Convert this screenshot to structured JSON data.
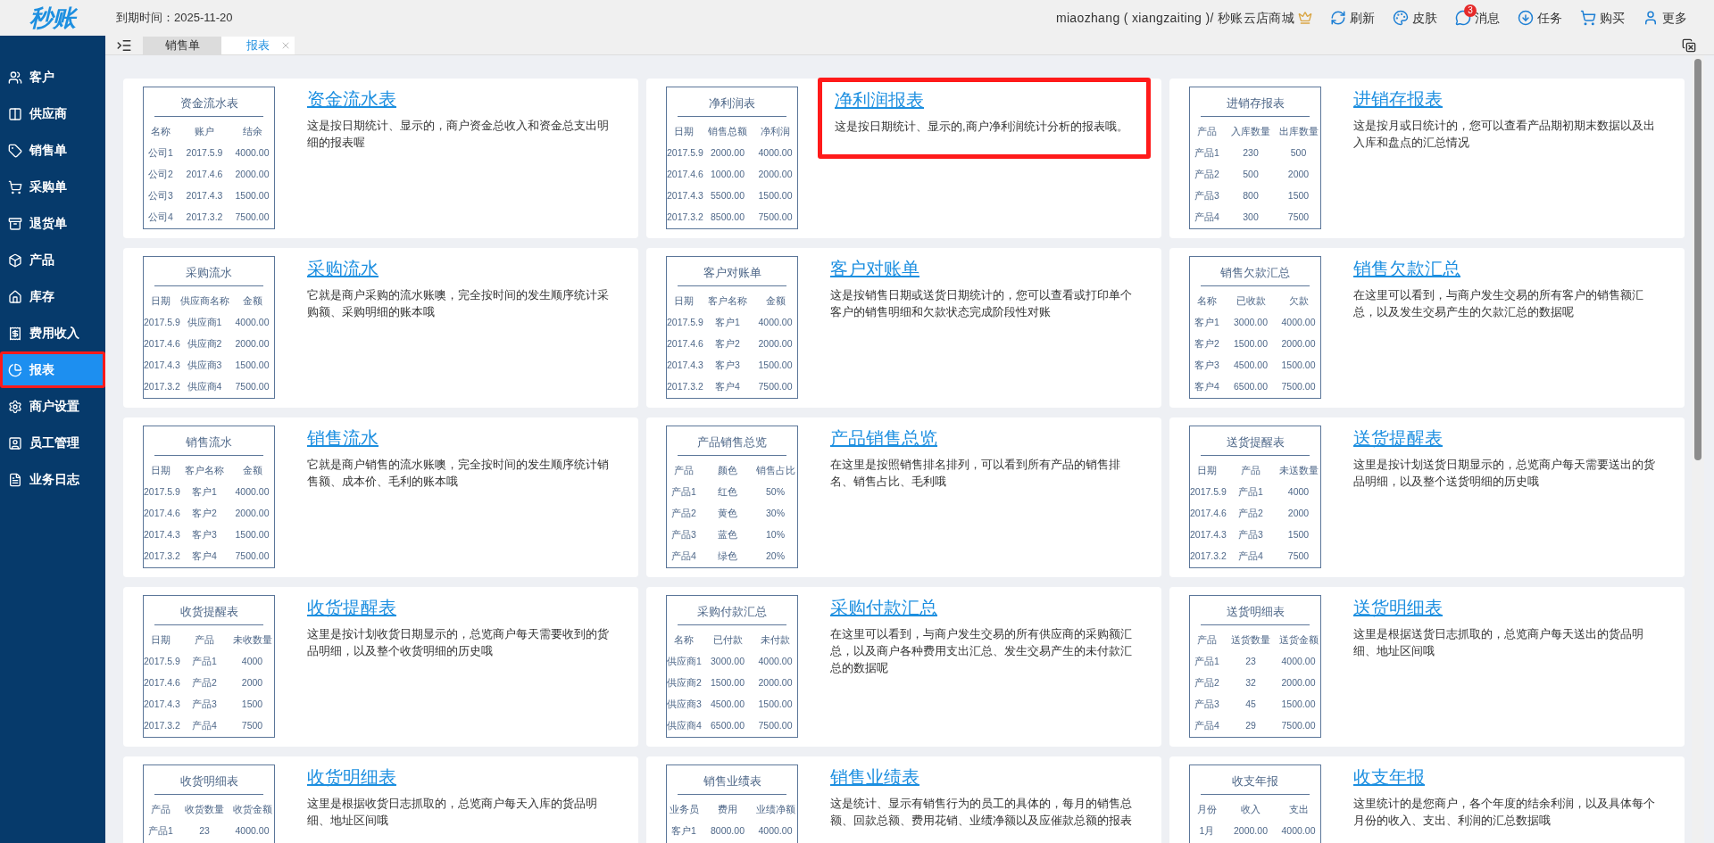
{
  "header": {
    "logo": "秒账",
    "expiry": "到期时间：2025-11-20",
    "account": "miaozhang ( xiangzaiting )/ 秒账云店商城",
    "actions": [
      {
        "kind": "refresh",
        "label": "刷新"
      },
      {
        "kind": "skin",
        "label": "皮肤"
      },
      {
        "kind": "message",
        "label": "消息",
        "badge": "3"
      },
      {
        "kind": "task",
        "label": "任务"
      },
      {
        "kind": "buy",
        "label": "购买"
      },
      {
        "kind": "more",
        "label": "更多"
      }
    ]
  },
  "tabs": [
    {
      "label": "销售单",
      "selected": false
    },
    {
      "label": "报表",
      "selected": true
    }
  ],
  "sidebar": {
    "items": [
      {
        "label": "客户",
        "selected": false,
        "highlighted": false
      },
      {
        "label": "供应商",
        "selected": false,
        "highlighted": false
      },
      {
        "label": "销售单",
        "selected": false,
        "highlighted": false
      },
      {
        "label": "采购单",
        "selected": false,
        "highlighted": false
      },
      {
        "label": "退货单",
        "selected": false,
        "highlighted": false
      },
      {
        "label": "产品",
        "selected": false,
        "highlighted": false
      },
      {
        "label": "库存",
        "selected": false,
        "highlighted": false
      },
      {
        "label": "费用收入",
        "selected": false,
        "highlighted": false
      },
      {
        "label": "报表",
        "selected": true,
        "highlighted": true
      },
      {
        "label": "商户设置",
        "selected": false,
        "highlighted": false
      },
      {
        "label": "员工管理",
        "selected": false,
        "highlighted": false
      },
      {
        "label": "业务日志",
        "selected": false,
        "highlighted": false
      }
    ]
  },
  "reports": [
    {
      "title": "资金流水表",
      "description": "这是按日期统计、显示的，商户资金总收入和资金总支出明细的报表喔",
      "highlighted": false,
      "preview": {
        "title": "资金流水表",
        "columns": [
          "名称",
          "账户",
          "结余"
        ],
        "rows": [
          [
            "公司1",
            "2017.5.9",
            "4000.00"
          ],
          [
            "公司2",
            "2017.4.6",
            "2000.00"
          ],
          [
            "公司3",
            "2017.4.3",
            "1500.00"
          ],
          [
            "公司4",
            "2017.3.2",
            "7500.00"
          ]
        ]
      }
    },
    {
      "title": "净利润报表",
      "description": "这是按日期统计、显示的,商户净利润统计分析的报表哦。",
      "highlighted": true,
      "preview": {
        "title": "净利润表",
        "columns": [
          "日期",
          "销售总额",
          "净利润"
        ],
        "rows": [
          [
            "2017.5.9",
            "2000.00",
            "4000.00"
          ],
          [
            "2017.4.6",
            "1000.00",
            "2000.00"
          ],
          [
            "2017.4.3",
            "5500.00",
            "1500.00"
          ],
          [
            "2017.3.2",
            "8500.00",
            "7500.00"
          ]
        ]
      }
    },
    {
      "title": "进销存报表",
      "description": "这是按月或日统计的，您可以查看产品期初期末数据以及出入库和盘点的汇总情况",
      "highlighted": false,
      "preview": {
        "title": "进销存报表",
        "columns": [
          "产品",
          "入库数量",
          "出库数量"
        ],
        "rows": [
          [
            "产品1",
            "230",
            "500"
          ],
          [
            "产品2",
            "500",
            "2000"
          ],
          [
            "产品3",
            "800",
            "1500"
          ],
          [
            "产品4",
            "300",
            "7500"
          ]
        ]
      }
    },
    {
      "title": "采购流水",
      "description": "它就是商户采购的流水账噢，完全按时间的发生顺序统计采购额、采购明细的账本哦",
      "highlighted": false,
      "preview": {
        "title": "采购流水",
        "columns": [
          "日期",
          "供应商名称",
          "金额"
        ],
        "rows": [
          [
            "2017.5.9",
            "供应商1",
            "4000.00"
          ],
          [
            "2017.4.6",
            "供应商2",
            "2000.00"
          ],
          [
            "2017.4.3",
            "供应商3",
            "1500.00"
          ],
          [
            "2017.3.2",
            "供应商4",
            "7500.00"
          ]
        ]
      }
    },
    {
      "title": "客户对账单",
      "description": "这是按销售日期或送货日期统计的，您可以查看或打印单个客户的销售明细和欠款状态完成阶段性对账",
      "highlighted": false,
      "preview": {
        "title": "客户对账单",
        "columns": [
          "日期",
          "客户名称",
          "金额"
        ],
        "rows": [
          [
            "2017.5.9",
            "客户1",
            "4000.00"
          ],
          [
            "2017.4.6",
            "客户2",
            "2000.00"
          ],
          [
            "2017.4.3",
            "客户3",
            "1500.00"
          ],
          [
            "2017.3.2",
            "客户4",
            "7500.00"
          ]
        ]
      }
    },
    {
      "title": "销售欠款汇总",
      "description": "在这里可以看到，与商户发生交易的所有客户的销售额汇总，以及发生交易产生的欠款汇总的数据呢",
      "highlighted": false,
      "preview": {
        "title": "销售欠款汇总",
        "columns": [
          "名称",
          "已收款",
          "欠款"
        ],
        "rows": [
          [
            "客户1",
            "3000.00",
            "4000.00"
          ],
          [
            "客户2",
            "1500.00",
            "2000.00"
          ],
          [
            "客户3",
            "4500.00",
            "1500.00"
          ],
          [
            "客户4",
            "6500.00",
            "7500.00"
          ]
        ]
      }
    },
    {
      "title": "销售流水",
      "description": "它就是商户销售的流水账噢，完全按时间的发生顺序统计销售额、成本价、毛利的账本哦",
      "highlighted": false,
      "preview": {
        "title": "销售流水",
        "columns": [
          "日期",
          "客户名称",
          "金额"
        ],
        "rows": [
          [
            "2017.5.9",
            "客户1",
            "4000.00"
          ],
          [
            "2017.4.6",
            "客户2",
            "2000.00"
          ],
          [
            "2017.4.3",
            "客户3",
            "1500.00"
          ],
          [
            "2017.3.2",
            "客户4",
            "7500.00"
          ]
        ]
      }
    },
    {
      "title": "产品销售总览",
      "description": "在这里是按照销售排名排列，可以看到所有产品的销售排名、销售占比、毛利哦",
      "highlighted": false,
      "preview": {
        "title": "产品销售总览",
        "columns": [
          "产品",
          "颜色",
          "销售占比"
        ],
        "rows": [
          [
            "产品1",
            "红色",
            "50%"
          ],
          [
            "产品2",
            "黄色",
            "30%"
          ],
          [
            "产品3",
            "蓝色",
            "10%"
          ],
          [
            "产品4",
            "绿色",
            "20%"
          ]
        ]
      }
    },
    {
      "title": "送货提醒表",
      "description": "这里是按计划送货日期显示的，总览商户每天需要送出的货品明细，以及整个送货明细的历史哦",
      "highlighted": false,
      "preview": {
        "title": "送货提醒表",
        "columns": [
          "日期",
          "产品",
          "未送数量"
        ],
        "rows": [
          [
            "2017.5.9",
            "产品1",
            "4000"
          ],
          [
            "2017.4.6",
            "产品2",
            "2000"
          ],
          [
            "2017.4.3",
            "产品3",
            "1500"
          ],
          [
            "2017.3.2",
            "产品4",
            "7500"
          ]
        ]
      }
    },
    {
      "title": "收货提醒表",
      "description": "这里是按计划收货日期显示的，总览商户每天需要收到的货品明细，以及整个收货明细的历史哦",
      "highlighted": false,
      "preview": {
        "title": "收货提醒表",
        "columns": [
          "日期",
          "产品",
          "未收数量"
        ],
        "rows": [
          [
            "2017.5.9",
            "产品1",
            "4000"
          ],
          [
            "2017.4.6",
            "产品2",
            "2000"
          ],
          [
            "2017.4.3",
            "产品3",
            "1500"
          ],
          [
            "2017.3.2",
            "产品4",
            "7500"
          ]
        ]
      }
    },
    {
      "title": "采购付款汇总",
      "description": "在这里可以看到，与商户发生交易的所有供应商的采购额汇总，以及商户各种费用支出汇总、发生交易产生的未付款汇总的数据呢",
      "highlighted": false,
      "preview": {
        "title": "采购付款汇总",
        "columns": [
          "名称",
          "已付款",
          "未付款"
        ],
        "rows": [
          [
            "供应商1",
            "3000.00",
            "4000.00"
          ],
          [
            "供应商2",
            "1500.00",
            "2000.00"
          ],
          [
            "供应商3",
            "4500.00",
            "1500.00"
          ],
          [
            "供应商4",
            "6500.00",
            "7500.00"
          ]
        ]
      }
    },
    {
      "title": "送货明细表",
      "description": "这里是根据送货日志抓取的，总览商户每天送出的货品明细、地址区间哦",
      "highlighted": false,
      "preview": {
        "title": "送货明细表",
        "columns": [
          "产品",
          "送货数量",
          "送货金额"
        ],
        "rows": [
          [
            "产品1",
            "23",
            "4000.00"
          ],
          [
            "产品2",
            "32",
            "2000.00"
          ],
          [
            "产品3",
            "45",
            "1500.00"
          ],
          [
            "产品4",
            "29",
            "7500.00"
          ]
        ]
      }
    },
    {
      "title": "收货明细表",
      "description": "这里是根据收货日志抓取的，总览商户每天入库的货品明细、地址区间哦",
      "highlighted": false,
      "preview": {
        "title": "收货明细表",
        "columns": [
          "产品",
          "收货数量",
          "收货金额"
        ],
        "rows": [
          [
            "产品1",
            "23",
            "4000.00"
          ]
        ]
      }
    },
    {
      "title": "销售业绩表",
      "description": "这是统计、显示有销售行为的员工的具体的，每月的销售总额、回款总额、费用花销、业绩净额以及应催款总额的报表",
      "highlighted": false,
      "preview": {
        "title": "销售业绩表",
        "columns": [
          "业务员",
          "费用",
          "业绩净额"
        ],
        "rows": [
          [
            "客户1",
            "8000.00",
            "4000.00"
          ]
        ]
      }
    },
    {
      "title": "收支年报",
      "description": "这里统计的是您商户，各个年度的结余利润，以及具体每个月份的收入、支出、利润的汇总数据哦",
      "highlighted": false,
      "preview": {
        "title": "收支年报",
        "columns": [
          "月份",
          "收入",
          "支出"
        ],
        "rows": [
          [
            "1月",
            "2000.00",
            "4000.00"
          ]
        ]
      }
    }
  ]
}
